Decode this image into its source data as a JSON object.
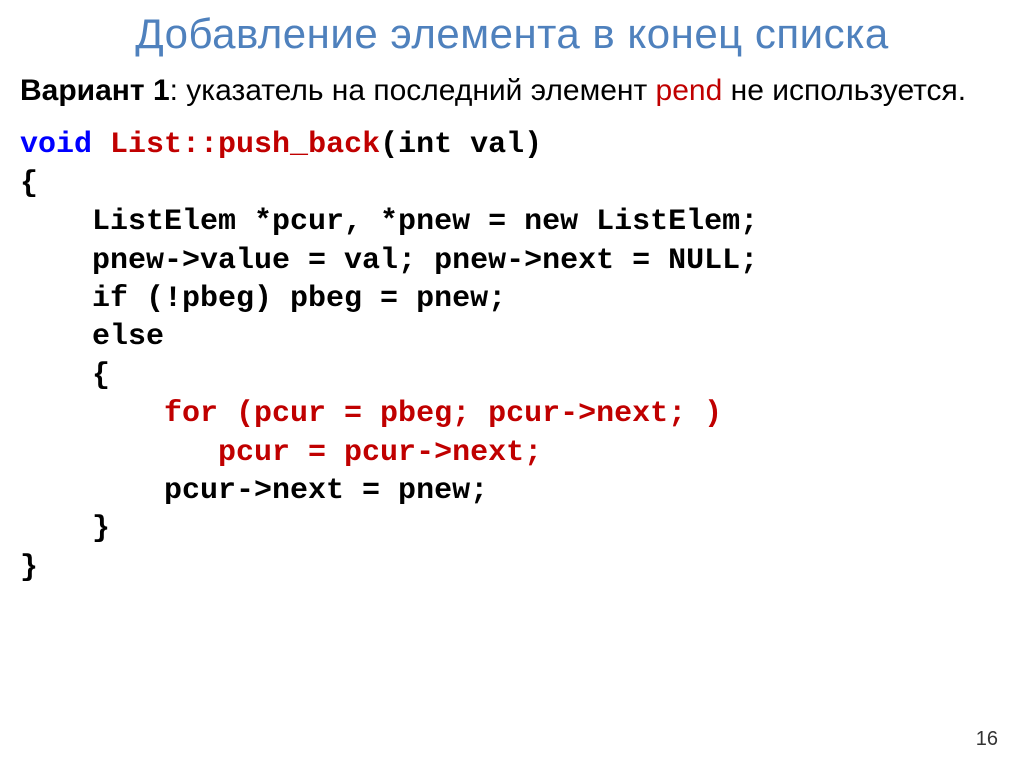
{
  "title": "Добавление элемента в конец списка",
  "intro": {
    "bold": "Вариант 1",
    "before_pend": ": указатель на последний элемент ",
    "pend": "pend",
    "after_pend": " не используется."
  },
  "code": {
    "l1_void": "void",
    "l1_space": " ",
    "l1_class": "List::push_back",
    "l1_rest": "(int val)",
    "l2": "{",
    "l3": "    ListElem *pcur, *pnew = new ListElem;",
    "l4": "    pnew->value = val; pnew->next = NULL;",
    "l5": "    if (!pbeg) pbeg = pnew;",
    "l6": "    else",
    "l7": "    {",
    "l8": "        for (pcur = pbeg; pcur->next; )",
    "l9": "           pcur = pcur->next;",
    "l10": "        pcur->next = pnew;",
    "l11": "    }",
    "l12": "}"
  },
  "page_number": "16"
}
